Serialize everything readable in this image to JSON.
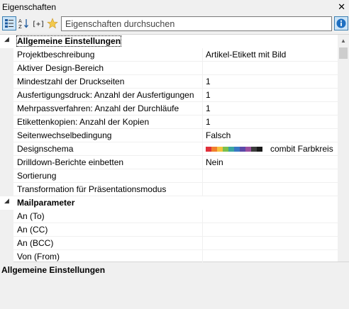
{
  "window": {
    "title": "Eigenschaften",
    "close_glyph": "✕"
  },
  "toolbar": {
    "buttons": [
      {
        "name": "categorized-view-icon",
        "active": true
      },
      {
        "name": "sort-alphabetical-icon",
        "active": false
      },
      {
        "name": "expand-collapse-icon",
        "active": false
      },
      {
        "name": "favorites-star-icon",
        "active": false
      }
    ],
    "search_placeholder": "Eigenschaften durchsuchen",
    "info_icon": "info-icon"
  },
  "categories": [
    {
      "label": "Allgemeine Einstellungen",
      "properties": [
        {
          "name": "Projektbeschreibung",
          "value": "Artikel-Etikett mit Bild"
        },
        {
          "name": "Aktiver Design-Bereich",
          "value": ""
        },
        {
          "name": "Mindestzahl der Druckseiten",
          "value": "1"
        },
        {
          "name": "Ausfertigungsdruck: Anzahl der Ausfertigungen",
          "value": "1"
        },
        {
          "name": "Mehrpassverfahren: Anzahl der Durchläufe",
          "value": "1"
        },
        {
          "name": "Etikettenkopien: Anzahl der Kopien",
          "value": "1"
        },
        {
          "name": "Seitenwechselbedingung",
          "value": "Falsch"
        },
        {
          "name": "Designschema",
          "value": "combit Farbkreis"
        },
        {
          "name": "Drilldown-Berichte einbetten",
          "value": "Nein"
        },
        {
          "name": "Sortierung",
          "value": ""
        },
        {
          "name": "Transformation für Präsentationsmodus",
          "value": ""
        }
      ]
    },
    {
      "label": "Mailparameter",
      "properties": [
        {
          "name": "An (To)",
          "value": ""
        },
        {
          "name": "An (CC)",
          "value": ""
        },
        {
          "name": "An (BCC)",
          "value": ""
        },
        {
          "name": "Von (From)",
          "value": ""
        }
      ]
    }
  ],
  "scheme_colors": [
    "#e0303a",
    "#f07f2d",
    "#f6c23e",
    "#7cc04d",
    "#3ba6a0",
    "#3a78c4",
    "#5a4aa8",
    "#9c4f9e",
    "#3d3d3d",
    "#1a1a1a"
  ],
  "description": {
    "title": "Allgemeine Einstellungen"
  }
}
